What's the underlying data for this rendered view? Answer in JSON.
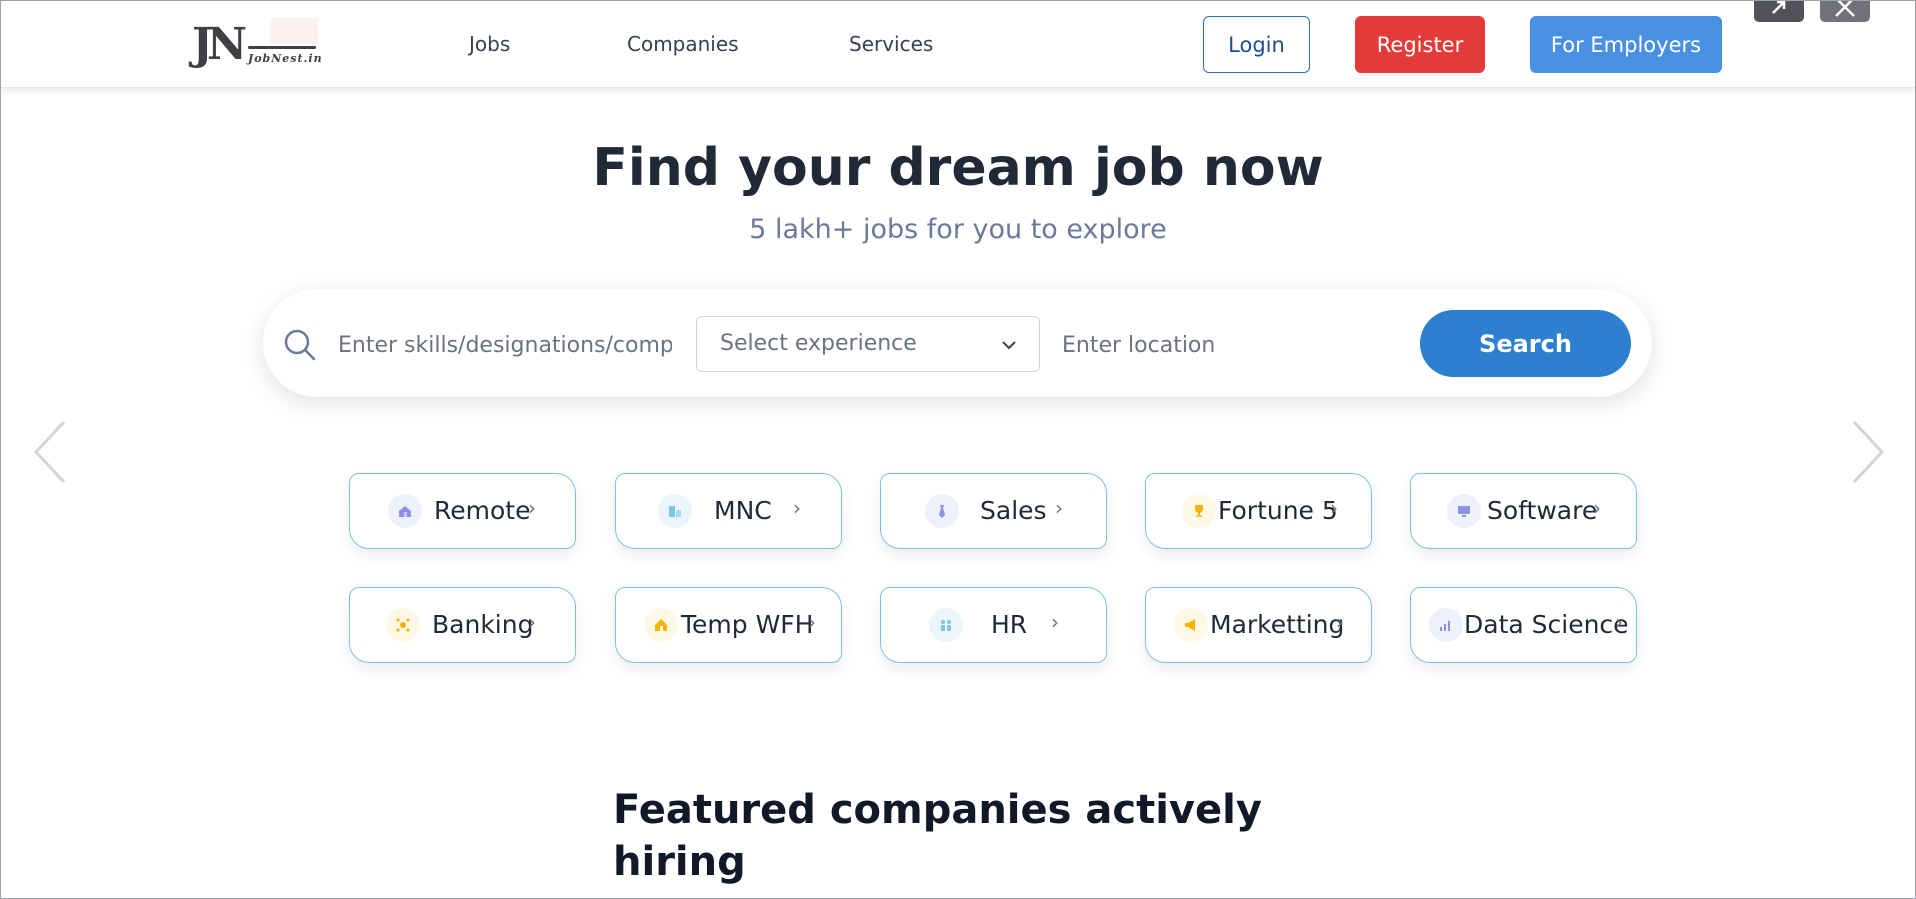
{
  "header": {
    "logo": {
      "monogram": "JN",
      "wordmark": "JobNest.in"
    },
    "nav": [
      {
        "label": "Jobs"
      },
      {
        "label": "Companies"
      },
      {
        "label": "Services"
      }
    ],
    "login_label": "Login",
    "register_label": "Register",
    "employers_label": "For Employers",
    "register_color": "#e43a3a",
    "employers_color": "#4a90e2"
  },
  "hero": {
    "title": "Find your dream job now",
    "subtitle": "5 lakh+ jobs for you to explore"
  },
  "search": {
    "skills_placeholder": "Enter skills/designations/companies",
    "experience_value": "Select experience",
    "location_placeholder": "Enter location",
    "button_label": "Search",
    "button_color": "#2d7fd0"
  },
  "categories": [
    {
      "label": "Remote",
      "icon": "home-icon"
    },
    {
      "label": "MNC",
      "icon": "building-icon"
    },
    {
      "label": "Sales",
      "icon": "tie-icon"
    },
    {
      "label": "Fortune 5",
      "icon": "trophy-icon"
    },
    {
      "label": "Software",
      "icon": "monitor-icon"
    },
    {
      "label": "Banking",
      "icon": "coin-icon"
    },
    {
      "label": "Temp WFH",
      "icon": "house-icon"
    },
    {
      "label": "HR",
      "icon": "people-icon"
    },
    {
      "label": "Marketting",
      "icon": "megaphone-icon"
    },
    {
      "label": "Data Science",
      "icon": "bar-chart-icon"
    }
  ],
  "featured": {
    "title": "Featured companies actively hiring"
  }
}
